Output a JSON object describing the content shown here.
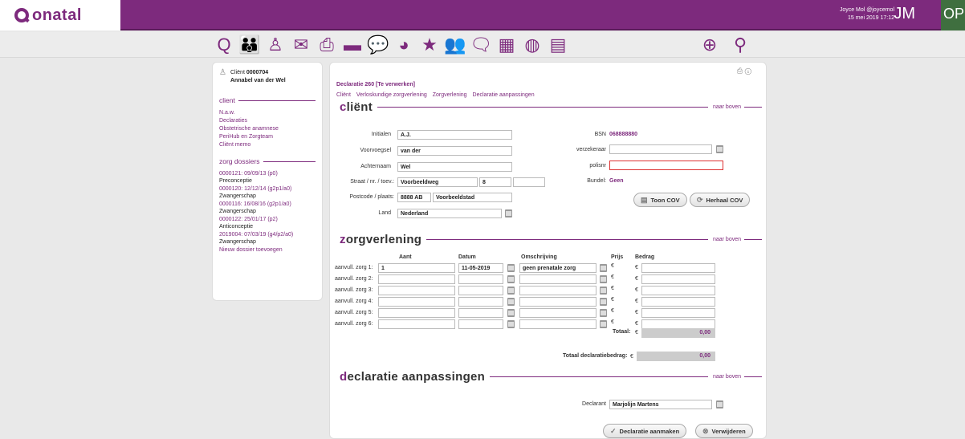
{
  "brand": {
    "name": "onatal"
  },
  "user": {
    "name": "Joyce Mol @joycemol",
    "datetime": "15 mei 2019 17:12",
    "initials": "JM",
    "org": "OP"
  },
  "toolbar": {
    "icons": [
      "onatal-q-icon",
      "users-icon",
      "person-add-icon",
      "mail-icon",
      "print-icon",
      "card-icon",
      "chat-icon",
      "pie-chart-icon",
      "star-icon",
      "group-icon",
      "conversation-icon",
      "calendar-icon",
      "globe-icon",
      "calculator-icon"
    ],
    "right_icons": [
      "plus-circle-icon",
      "search-icon"
    ],
    "accent": "#7d2a7d"
  },
  "sidebar": {
    "client_label": "Cliënt",
    "client_number": "0000704",
    "client_name": "Annabel van der Wel",
    "client_section": "client",
    "links": [
      "N.a.w.",
      "Declaraties",
      "Obstetrische anamnese",
      "PeriHub en Zorgteam",
      "Cliënt memo"
    ],
    "dossier_section": "zorg dossiers",
    "dossiers": [
      {
        "id": "0000121: 09/09/13 (p0)",
        "type": "Preconceptie"
      },
      {
        "id": "0000120: 12/12/14 (g2p1/a0)",
        "type": "Zwangerschap"
      },
      {
        "id": "0000116: 16/08/16 (g2p1/a0)",
        "type": "Zwangerschap"
      },
      {
        "id": "0000122: 25/01/17 (p2)",
        "type": "Anticonceptie"
      },
      {
        "id": "2019004: 07/03/19 (g4/p2/a0)",
        "type": "Zwangerschap"
      }
    ],
    "new_dossier": "Nieuw dossier toevoegen"
  },
  "main": {
    "title": "Declaratie 260 [Te verwerken]",
    "crumbs": [
      "Cliënt",
      "Verloskundige zorgverlening",
      "Zorgverlening",
      "Declaratie aanpassingen"
    ],
    "naar_boven": "naar boven",
    "client": {
      "heading_cap": "c",
      "heading_rest": "liënt",
      "initialen_label": "Initialen",
      "initialen": "A.J.",
      "voorvoegsel_label": "Voorvoegsel",
      "voorvoegsel": "van der",
      "achternaam_label": "Achternaam",
      "achternaam": "Wel",
      "straat_label": "Straat / nr. / toev.:",
      "straat": "Voorbeeldweg",
      "nr": "8",
      "toev": "",
      "postcode_label": "Postcode / plaats:",
      "postcode": "8888 AB",
      "plaats": "Voorbeeldstad",
      "land_label": "Land",
      "land": "Nederland",
      "bsn_label": "BSN",
      "bsn": "068888880",
      "verzekeraar_label": "verzekeraar",
      "verzekeraar": "",
      "polisnr_label": "polisnr",
      "polisnr": "",
      "bundel_label": "Bundel:",
      "bundel": "Geen",
      "toon_cov": "Toon COV",
      "herhaal_cov": "Herhaal COV"
    },
    "zorg": {
      "heading_cap": "z",
      "heading_rest": "orgverlening",
      "col_aant": "Aant",
      "col_datum": "Datum",
      "col_omschrijving": "Omschrijving",
      "col_prijs": "Prijs",
      "col_bedrag": "Bedrag",
      "rows": [
        {
          "label": "aanvull. zorg 1:",
          "aant": "1",
          "datum": "11-05-2019",
          "omschrijving": "geen prenatale zorg",
          "bedrag": ""
        },
        {
          "label": "aanvull. zorg 2:",
          "aant": "",
          "datum": "",
          "omschrijving": "",
          "bedrag": ""
        },
        {
          "label": "aanvull. zorg 3:",
          "aant": "",
          "datum": "",
          "omschrijving": "",
          "bedrag": ""
        },
        {
          "label": "aanvull. zorg 4:",
          "aant": "",
          "datum": "",
          "omschrijving": "",
          "bedrag": ""
        },
        {
          "label": "aanvull. zorg 5:",
          "aant": "",
          "datum": "",
          "omschrijving": "",
          "bedrag": ""
        },
        {
          "label": "aanvull. zorg 6:",
          "aant": "",
          "datum": "",
          "omschrijving": "",
          "bedrag": ""
        }
      ],
      "euro": "€",
      "totaal_label": "Totaal:",
      "totaal": "0,00",
      "totaal_decl_label": "Totaal declaratiebedrag:",
      "totaal_decl": "0,00"
    },
    "aanpassingen": {
      "heading_cap": "d",
      "heading_rest": "eclaratie aanpassingen",
      "declarant_label": "Declarant",
      "declarant": "Marjolijn Martens",
      "aanmaken": "Declaratie aanmaken",
      "verwijderen": "Verwijderen"
    }
  }
}
